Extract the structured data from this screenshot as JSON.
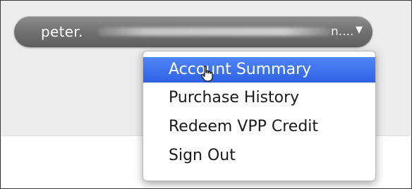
{
  "account": {
    "name_visible": "peter.",
    "name_suffix": "n....",
    "dropdown_icon": "triangle-down-icon"
  },
  "menu": {
    "items": [
      {
        "label": "Account Summary",
        "selected": true
      },
      {
        "label": "Purchase History",
        "selected": false
      },
      {
        "label": "Redeem VPP Credit",
        "selected": false
      },
      {
        "label": "Sign Out",
        "selected": false
      }
    ]
  },
  "colors": {
    "selection": "#3b6ff0",
    "pill": "#707070"
  },
  "cursor": {
    "icon": "hand-pointer-icon"
  }
}
